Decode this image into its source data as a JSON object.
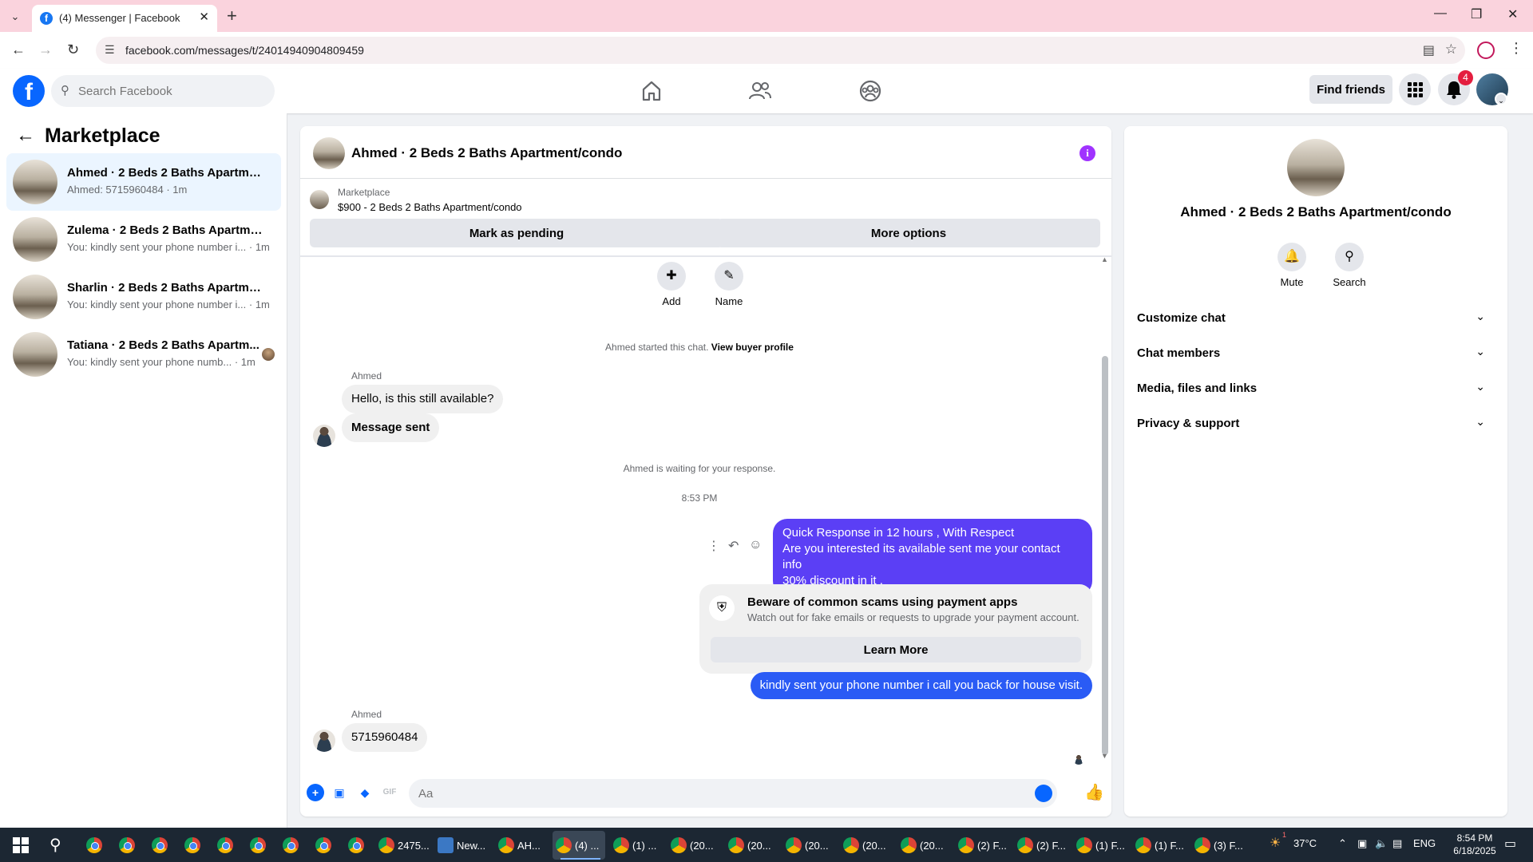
{
  "browser": {
    "tab_title": "(4) Messenger | Facebook",
    "url": "facebook.com/messages/t/24014940904809459"
  },
  "fb": {
    "search_placeholder": "Search Facebook",
    "find_friends": "Find friends",
    "notification_count": "4"
  },
  "left": {
    "heading": "Marketplace",
    "conversations": [
      {
        "name": "Ahmed · 2 Beds 2 Baths Apartmen...",
        "snippet": "Ahmed: 5715960484 · 1m"
      },
      {
        "name": "Zulema · 2 Beds 2 Baths Apartmen...",
        "snippet": "You: kindly sent your phone number i... · 1m"
      },
      {
        "name": "Sharlin · 2 Beds 2 Baths Apartment...",
        "snippet": "You: kindly sent your phone number i... · 1m"
      },
      {
        "name": "Tatiana · 2 Beds 2 Baths Apartm...",
        "snippet": "You: kindly sent your phone numb... · 1m"
      }
    ]
  },
  "chat": {
    "title": "Ahmed · 2 Beds 2 Baths Apartment/condo",
    "marketplace_label": "Marketplace",
    "listing": "$900 - 2 Beds 2 Baths Apartment/condo",
    "mark_pending": "Mark as pending",
    "more_options": "More options",
    "add_label": "Add",
    "name_label": "Name",
    "started_text": "Ahmed started this chat.",
    "view_buyer": "View buyer profile",
    "sender1": "Ahmed",
    "msg1": "Hello, is this still available?",
    "msg2": "Message sent",
    "waiting": "Ahmed is waiting for your response.",
    "time": "8:53 PM",
    "out1_line1": "Quick Response in 12 hours , With Respect",
    "out1_line2": "Are you interested its available sent me your contact info",
    "out1_line3": "30% discount in it .",
    "scam_title": "Beware of common scams using payment apps",
    "scam_sub": "Watch out for fake emails or requests to upgrade your payment account.",
    "learn_more": "Learn More",
    "out2": "kindly sent your phone number i call you back for house visit.",
    "sender2": "Ahmed",
    "msg3": "5715960484",
    "composer_placeholder": "Aa"
  },
  "right": {
    "name": "Ahmed · 2 Beds 2 Baths Apartment/condo",
    "mute": "Mute",
    "search": "Search",
    "sections": [
      "Customize chat",
      "Chat members",
      "Media, files and links",
      "Privacy & support"
    ]
  },
  "taskbar": {
    "windows": [
      "2475...",
      "New...",
      "AH...",
      "(4) ...",
      "(1) ...",
      "(20...",
      "(20...",
      "(20...",
      "(20...",
      "(20...",
      "(2) F...",
      "(2) F...",
      "(1) F...",
      "(1) F...",
      "(3) F..."
    ],
    "temperature": "37°C",
    "weather_badge": "1",
    "lang": "ENG",
    "time": "8:54 PM",
    "date": "6/18/2025"
  },
  "colors": {
    "fb_blue": "#0866ff",
    "outgoing_bubble": "#5b3ff5",
    "outgoing_bubble_2": "#2a5bf5",
    "tab_strip": "#fad3dd"
  }
}
